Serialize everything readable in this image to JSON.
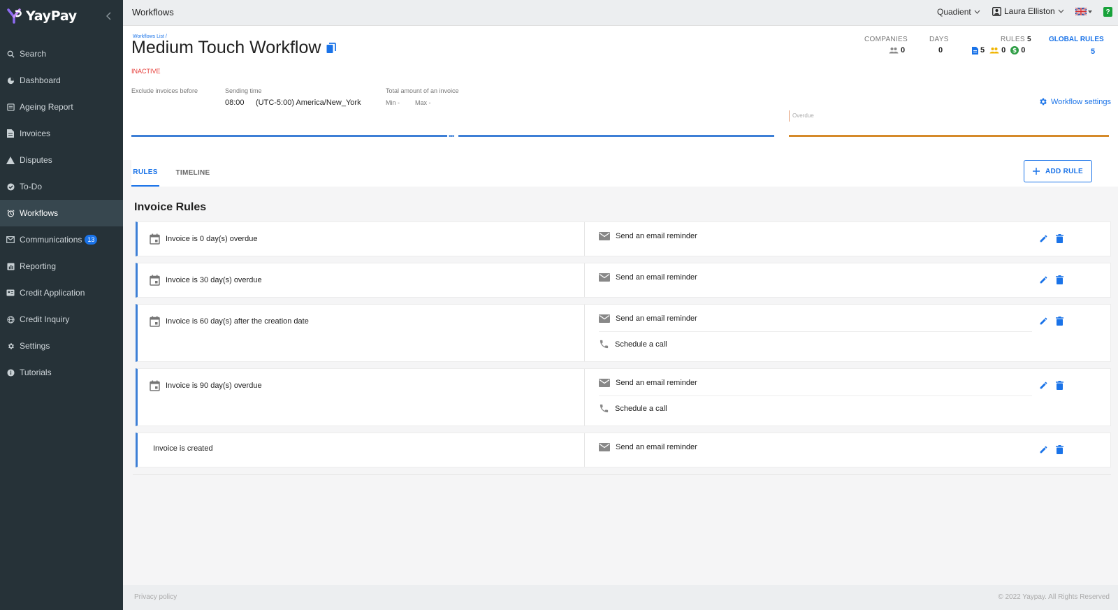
{
  "app": {
    "name": "YayPay"
  },
  "sidebar": {
    "items": [
      {
        "label": "Search",
        "icon": "search-icon"
      },
      {
        "label": "Dashboard",
        "icon": "pie-chart-icon"
      },
      {
        "label": "Ageing Report",
        "icon": "report-icon"
      },
      {
        "label": "Invoices",
        "icon": "document-icon"
      },
      {
        "label": "Disputes",
        "icon": "warning-icon"
      },
      {
        "label": "To-Do",
        "icon": "check-circle-icon"
      },
      {
        "label": "Workflows",
        "icon": "alarm-icon",
        "active": true
      },
      {
        "label": "Communications",
        "icon": "mail-icon",
        "badge": "13"
      },
      {
        "label": "Reporting",
        "icon": "chart-icon"
      },
      {
        "label": "Credit Application",
        "icon": "id-card-icon"
      },
      {
        "label": "Credit Inquiry",
        "icon": "globe-icon"
      },
      {
        "label": "Settings",
        "icon": "gear-icon"
      },
      {
        "label": "Tutorials",
        "icon": "info-icon"
      }
    ]
  },
  "topbar": {
    "title": "Workflows",
    "company": "Quadient",
    "user": "Laura Elliston",
    "help": "?"
  },
  "workflow": {
    "breadcrumb": "Workflows List /",
    "title": "Medium Touch Workflow",
    "status": "INACTIVE",
    "exclude_label": "Exclude invoices before",
    "sending_time_label": "Sending time",
    "sending_time": "08:00",
    "timezone": "(UTC-5:00) America/New_York",
    "total_amount_label": "Total amount of an invoice",
    "min_label": "Min -",
    "max_label": "Max -",
    "settings_label": "Workflow settings",
    "overdue_label": "Overdue",
    "timeline_dots": "•••"
  },
  "stats": {
    "companies_label": "COMPANIES",
    "companies_value": "0",
    "days_label": "DAYS",
    "days_value": "0",
    "rules_label": "RULES",
    "rules_total": "5",
    "rules_invoice": "5",
    "rules_customer": "0",
    "rules_payment": "0",
    "global_rules_label": "GLOBAL RULES",
    "global_rules_value": "5"
  },
  "tabs": [
    {
      "label": "RULES",
      "active": true
    },
    {
      "label": "TIMELINE",
      "active": false
    }
  ],
  "add_rule_label": "ADD RULE",
  "section_title": "Invoice Rules",
  "rules": [
    {
      "condition": "Invoice is 0 day(s) overdue",
      "has_icon": true,
      "actions": [
        "Send an email reminder"
      ]
    },
    {
      "condition": "Invoice is 30 day(s) overdue",
      "has_icon": true,
      "actions": [
        "Send an email reminder"
      ]
    },
    {
      "condition": "Invoice is 60 day(s) after the creation date",
      "has_icon": true,
      "actions": [
        "Send an email reminder",
        "Schedule a call"
      ]
    },
    {
      "condition": "Invoice is 90 day(s) overdue",
      "has_icon": true,
      "actions": [
        "Send an email reminder",
        "Schedule a call"
      ]
    },
    {
      "condition": "Invoice is created",
      "has_icon": false,
      "actions": [
        "Send an email reminder"
      ]
    }
  ],
  "footer": {
    "privacy": "Privacy policy",
    "copyright": "© 2022 Yaypay. All Rights Reserved"
  },
  "colors": {
    "accent": "#1a73e8",
    "sidebar": "#263238",
    "inactive": "#e53935",
    "timeline_overdue": "#d58a2a"
  }
}
